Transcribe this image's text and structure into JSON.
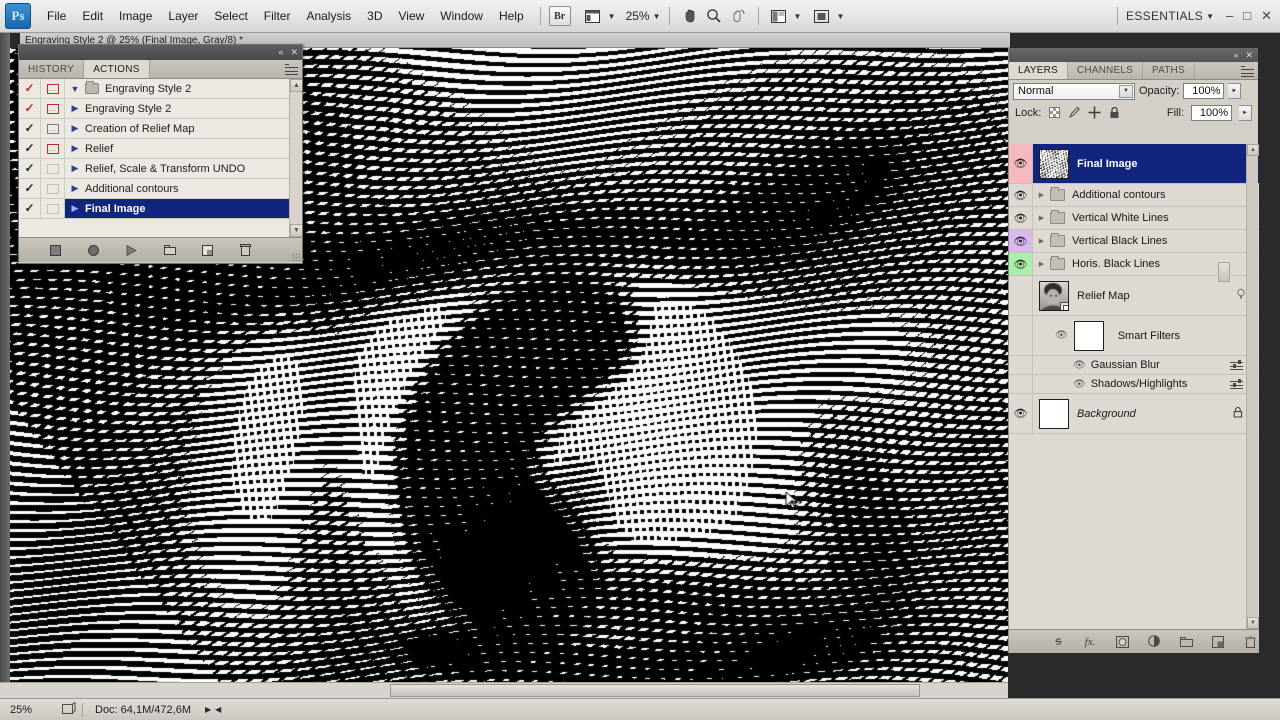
{
  "app": {
    "name": "Adobe Photoshop",
    "logo_text": "Ps",
    "workspace": "ESSENTIALS",
    "zoom_level": "25%"
  },
  "menubar": {
    "items": [
      "File",
      "Edit",
      "Image",
      "Layer",
      "Select",
      "Filter",
      "Analysis",
      "3D",
      "View",
      "Window",
      "Help"
    ],
    "bridge_label": "Br",
    "window_buttons": [
      "minimize",
      "maximize",
      "close"
    ]
  },
  "document": {
    "tab_title": "Engraving Style 2 @ 25% (Final Image, Gray/8) *"
  },
  "actions_panel": {
    "tabs": [
      {
        "label": "HISTORY",
        "active": false
      },
      {
        "label": "ACTIONS",
        "active": true
      }
    ],
    "rows": [
      {
        "label": "Engraving Style 2",
        "checked": true,
        "check_color": "red",
        "dialog": "on",
        "type": "set",
        "expanded": true,
        "selected": false
      },
      {
        "label": "Engraving Style 2",
        "checked": true,
        "check_color": "red",
        "dialog": "on",
        "type": "action",
        "selected": false
      },
      {
        "label": "Creation of Relief Map",
        "checked": true,
        "check_color": "dark",
        "dialog": "on-dark",
        "type": "action",
        "selected": false
      },
      {
        "label": "Relief",
        "checked": true,
        "check_color": "dark",
        "dialog": "on",
        "type": "action",
        "selected": false
      },
      {
        "label": "Relief, Scale & Transform UNDO",
        "checked": true,
        "check_color": "dark",
        "dialog": "off",
        "type": "action",
        "selected": false
      },
      {
        "label": "Additional contours",
        "checked": true,
        "check_color": "dark",
        "dialog": "off",
        "type": "action",
        "selected": false
      },
      {
        "label": "Final Image",
        "checked": true,
        "check_color": "dark",
        "dialog": "off",
        "type": "action",
        "selected": true
      }
    ],
    "footer_buttons": [
      "stop-icon",
      "record-icon",
      "play-icon",
      "new-set-icon",
      "new-action-icon",
      "delete-icon"
    ]
  },
  "layers_panel": {
    "tabs": [
      {
        "label": "LAYERS",
        "active": true
      },
      {
        "label": "CHANNELS",
        "active": false
      },
      {
        "label": "PATHS",
        "active": false
      }
    ],
    "blend_mode": "Normal",
    "opacity_label": "Opacity:",
    "opacity_value": "100%",
    "fill_label": "Fill:",
    "fill_value": "100%",
    "lock_label": "Lock:",
    "lock_icons": [
      "lock-transparency-icon",
      "lock-image-icon",
      "lock-position-icon",
      "lock-all-icon"
    ],
    "layers": [
      {
        "name": "Final Image",
        "type": "layer",
        "visible": true,
        "selected": true,
        "highlight": "pink",
        "thumb": "engraving"
      },
      {
        "name": "Additional contours",
        "type": "group",
        "visible": true,
        "selected": false,
        "highlight": "none"
      },
      {
        "name": "Vertical White Lines",
        "type": "group",
        "visible": true,
        "selected": false,
        "highlight": "none"
      },
      {
        "name": "Vertical Black Lines",
        "type": "group",
        "visible": true,
        "selected": false,
        "highlight": "purple"
      },
      {
        "name": "Horis. Black Lines",
        "type": "group",
        "visible": true,
        "selected": false,
        "highlight": "green"
      },
      {
        "name": "Relief Map",
        "type": "smart-object",
        "visible": false,
        "selected": false,
        "highlight": "none",
        "thumb": "portrait"
      },
      {
        "name": "Smart Filters",
        "type": "smart-filter-header",
        "visible": true,
        "selected": false
      },
      {
        "name": "Gaussian Blur",
        "type": "smart-filter",
        "visible": true,
        "selected": false
      },
      {
        "name": "Shadows/Highlights",
        "type": "smart-filter",
        "visible": true,
        "selected": false
      },
      {
        "name": "Background",
        "type": "background",
        "visible": true,
        "selected": false,
        "locked": true
      }
    ],
    "footer_buttons": [
      "link-layers-icon",
      "layer-style-fx-icon",
      "layer-mask-icon",
      "adjustment-layer-icon",
      "new-group-icon",
      "new-layer-icon",
      "delete-layer-icon"
    ]
  },
  "statusbar": {
    "zoom": "25%",
    "doc_info": "Doc: 64,1M/472,6M"
  },
  "colors": {
    "selection_blue": "#11247e",
    "panel_bg": "#d4d0c8",
    "list_bg": "#ded9d1",
    "menu_bg": "#e4e4e4",
    "highlight_pink": "#f6b9bf",
    "highlight_purple": "#d9b7ef",
    "highlight_green": "#a9efa9"
  }
}
